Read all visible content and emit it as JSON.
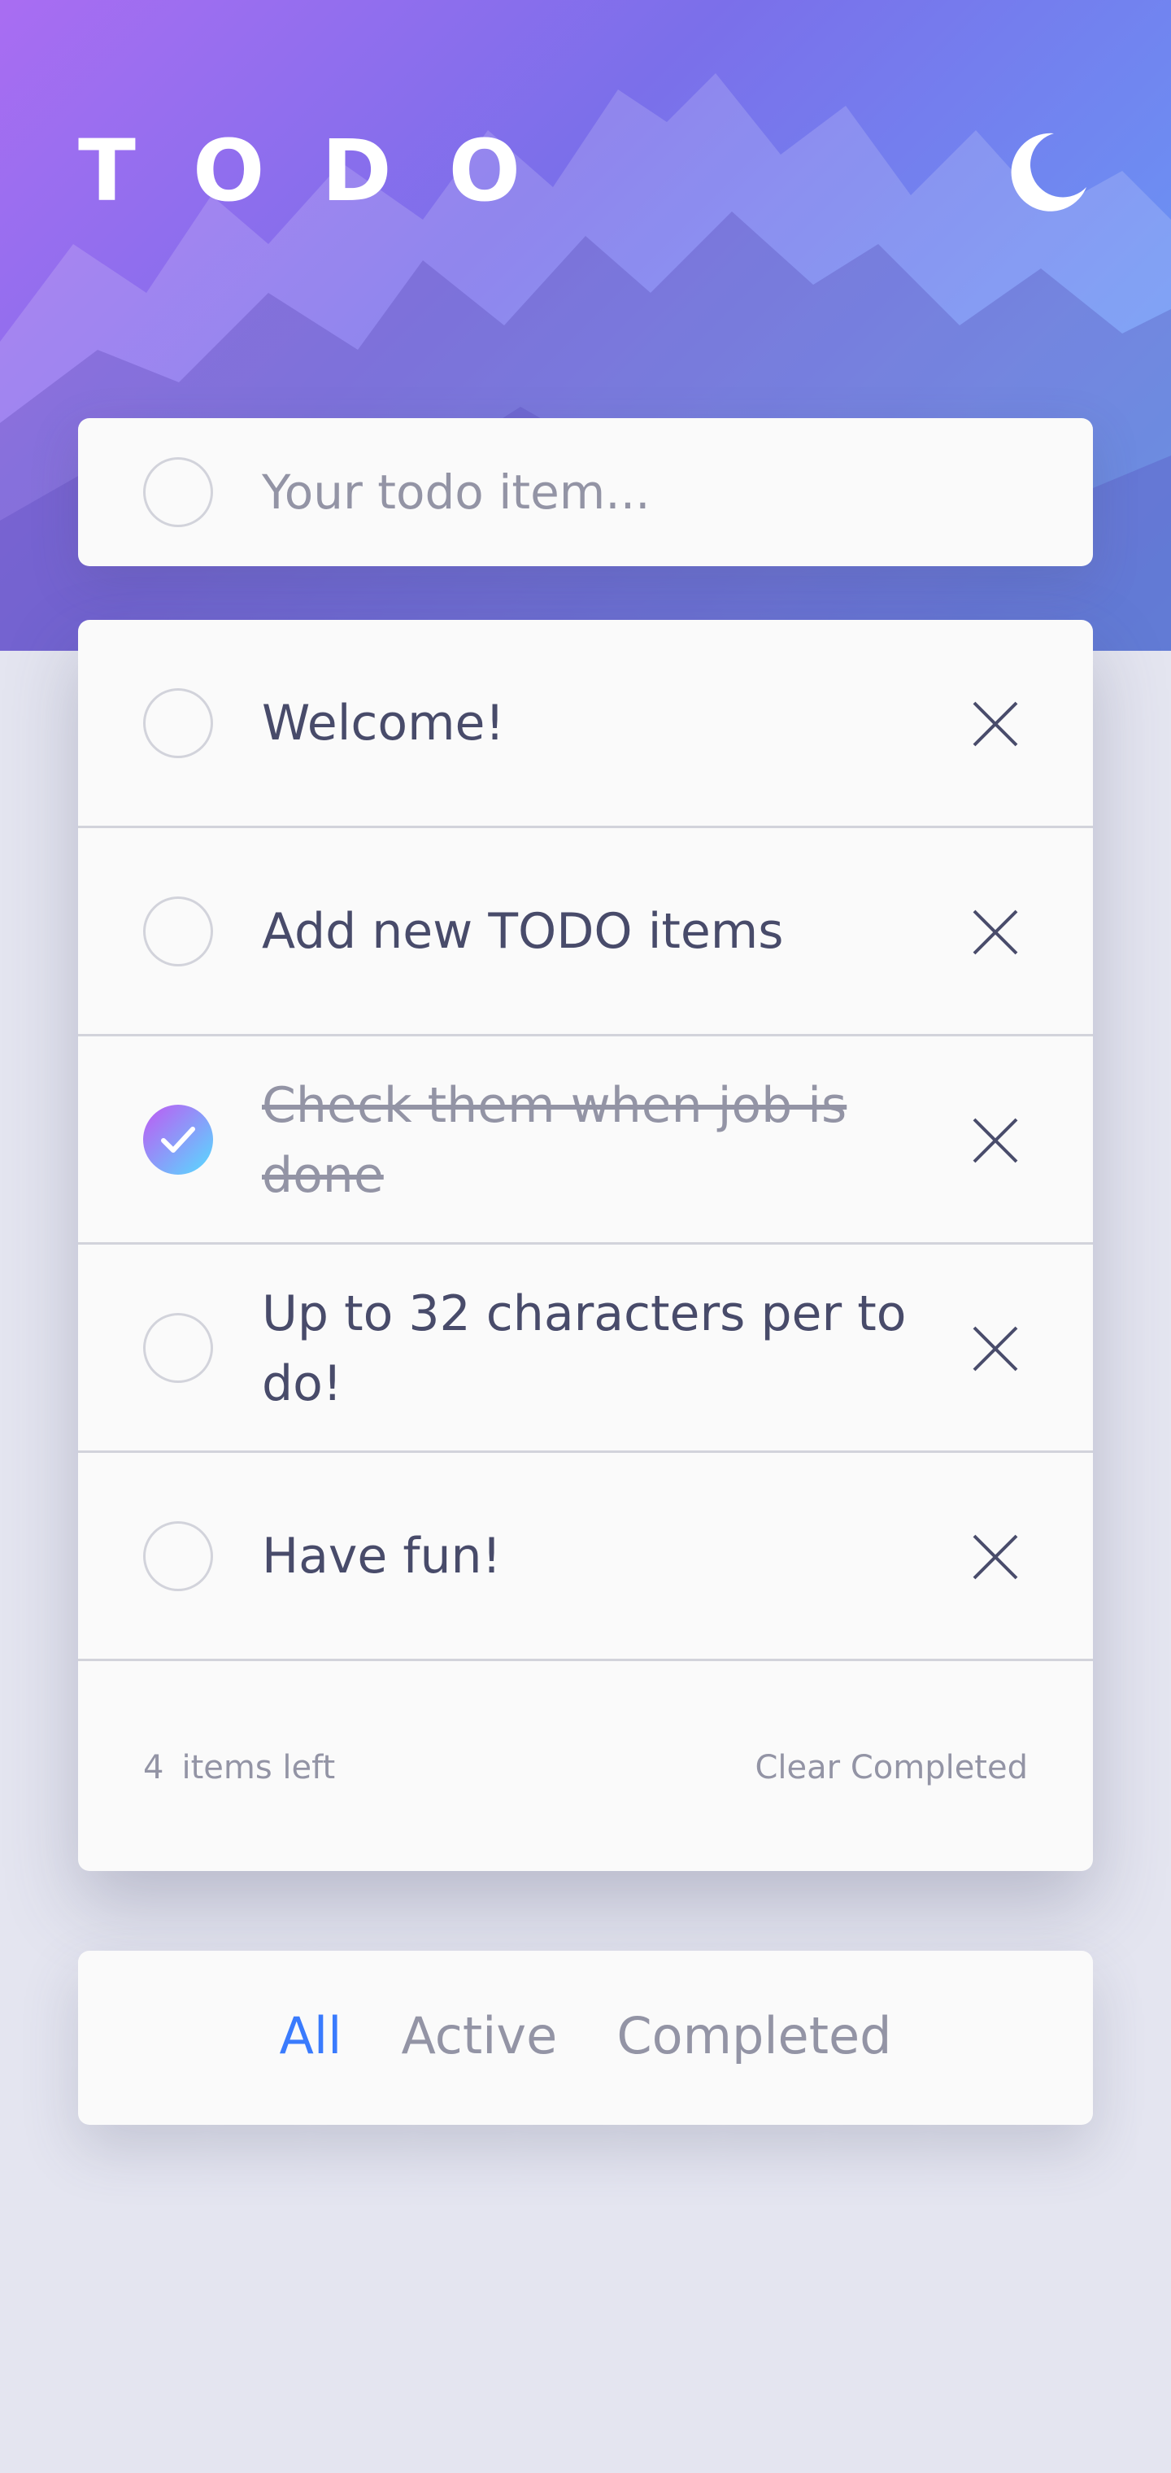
{
  "header": {
    "title": "TODO",
    "theme_icon": "moon-icon"
  },
  "new_todo": {
    "placeholder": "Your todo item..."
  },
  "todos": [
    {
      "text": "Welcome!",
      "completed": false
    },
    {
      "text": "Add new TODO items",
      "completed": false
    },
    {
      "text": "Check them when job is done",
      "completed": true
    },
    {
      "text": "Up to 32 characters per to do!",
      "completed": false
    },
    {
      "text": "Have fun!",
      "completed": false
    }
  ],
  "footer": {
    "items_left_count": "4",
    "items_left_label": "items left",
    "clear_completed_label": "Clear Completed"
  },
  "filters": {
    "all": "All",
    "active": "Active",
    "completed": "Completed",
    "selected": "All"
  },
  "colors": {
    "accent": "#3a7bfd",
    "check_gradient_start": "#c058f3",
    "check_gradient_end": "#55ddff",
    "text": "#484b6a",
    "muted": "#9394a5",
    "page_background": "#e4e5f0",
    "card_background": "#fafafa"
  }
}
